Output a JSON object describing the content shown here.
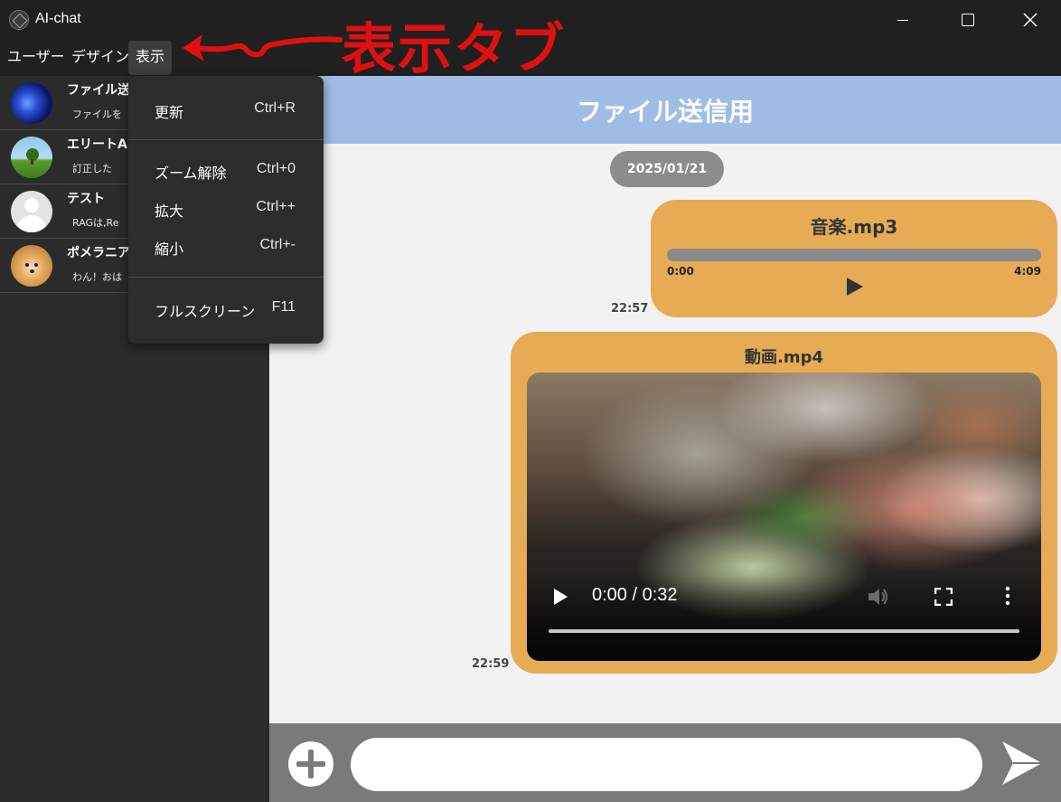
{
  "window": {
    "title": "AI-chat"
  },
  "menubar": {
    "items": [
      "ユーザー",
      "デザイン",
      "表示"
    ]
  },
  "annotation": {
    "text": "表示タブ",
    "color": "#e01010"
  },
  "view_menu": {
    "items": [
      {
        "label": "更新",
        "shortcut": "Ctrl+R"
      },
      {
        "label": "ズーム解除",
        "shortcut": "Ctrl+0"
      },
      {
        "label": "拡大",
        "shortcut": "Ctrl++"
      },
      {
        "label": "縮小",
        "shortcut": "Ctrl+-"
      },
      {
        "label": "フルスクリーン",
        "shortcut": "F11"
      }
    ]
  },
  "sidebar": {
    "chats": [
      {
        "name": "ファイル送",
        "preview": "ファイルを",
        "avatar": "starry-sky"
      },
      {
        "name": "エリートAI",
        "preview": "訂正した",
        "avatar": "tree-field"
      },
      {
        "name": "テスト",
        "preview": "RAGは,Re",
        "avatar": "default-user"
      },
      {
        "name": "ポメラニア",
        "preview": "わん！おは",
        "avatar": "pomeranian"
      }
    ]
  },
  "chat": {
    "title": "ファイル送信用",
    "date": "2025/01/21",
    "messages": [
      {
        "type": "audio",
        "filename": "音楽.mp3",
        "current": "0:00",
        "duration": "4:09",
        "time": "22:57"
      },
      {
        "type": "video",
        "filename": "動画.mp4",
        "timecode": "0:00 / 0:32",
        "time": "22:59"
      }
    ]
  },
  "colors": {
    "header": "#9fbde5",
    "bubble": "#e8ab55",
    "sidebar": "#2b2b2b",
    "titlebar": "#202020",
    "input_bar": "#7a7a7a",
    "date_badge": "#8c8c8c"
  },
  "input": {
    "placeholder": ""
  }
}
